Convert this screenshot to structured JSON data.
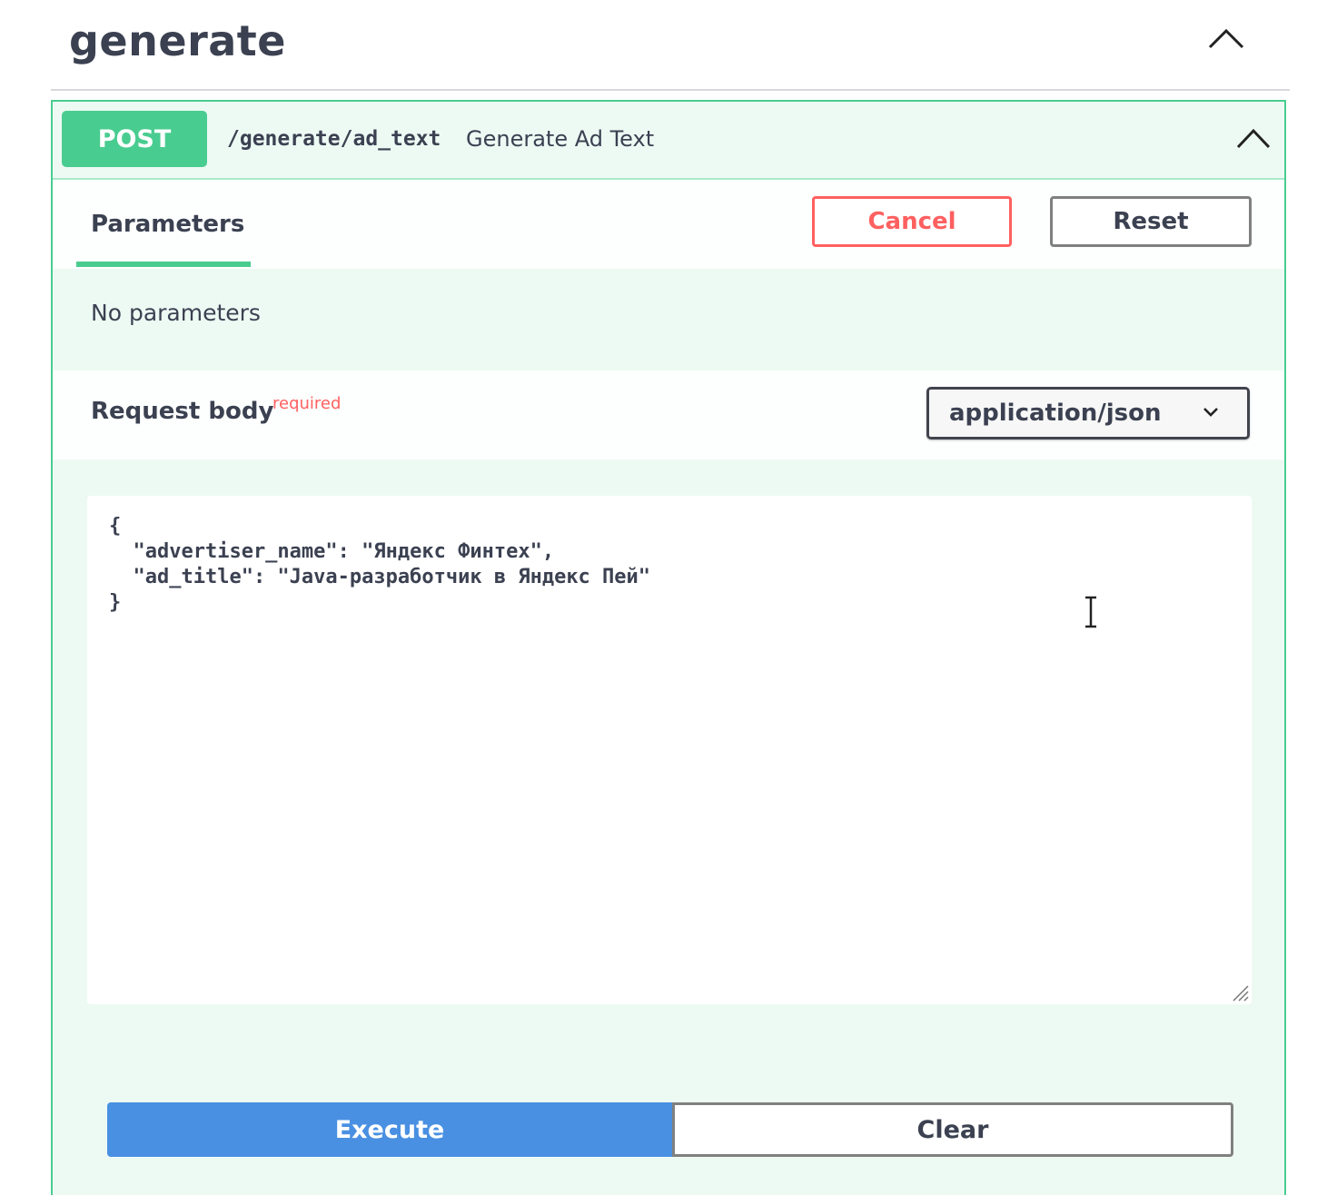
{
  "tag": {
    "title": "generate"
  },
  "operation": {
    "method": "POST",
    "path": "/generate/ad_text",
    "summary": "Generate Ad Text"
  },
  "parameters": {
    "tab_label": "Parameters",
    "cancel_label": "Cancel",
    "reset_label": "Reset",
    "empty_text": "No parameters"
  },
  "request_body": {
    "title": "Request body",
    "required_label": "required",
    "content_type": "application/json",
    "value": "{\n  \"advertiser_name\": \"Яндекс Финтех\",\n  \"ad_title\": \"Java-разработчик в Яндекс Пей\"\n}"
  },
  "actions": {
    "execute_label": "Execute",
    "clear_label": "Clear"
  },
  "colors": {
    "post_green": "#49cc90",
    "opblock_bg": "#edfaf4",
    "cancel_red": "#ff6060",
    "execute_blue": "#4990e2",
    "text": "#3b4151"
  },
  "icons": {
    "tag_collapse": "chevron-up-icon",
    "operation_collapse": "chevron-up-icon",
    "select_arrow": "chevron-down-icon",
    "resize": "resize-handle-icon",
    "cursor": "text-cursor-icon"
  }
}
